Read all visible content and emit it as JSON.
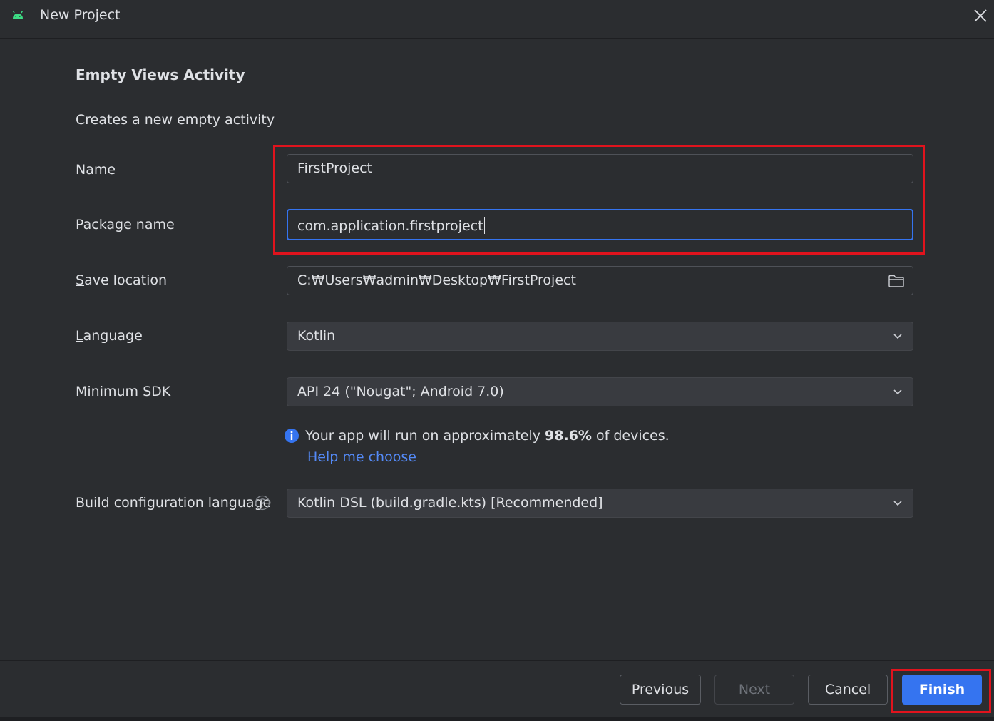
{
  "window": {
    "title": "New Project"
  },
  "template": {
    "heading": "Empty Views Activity",
    "description": "Creates a new empty activity"
  },
  "form": {
    "name": {
      "label_mnemonic": "N",
      "label_rest": "ame",
      "value": "FirstProject"
    },
    "package_name": {
      "label_mnemonic": "P",
      "label_rest": "ackage name",
      "value": "com.application.firstproject"
    },
    "save_location": {
      "label_mnemonic": "S",
      "label_rest": "ave location",
      "value": "C:₩Users₩admin₩Desktop₩FirstProject"
    },
    "language": {
      "label_mnemonic": "L",
      "label_rest": "anguage",
      "value": "Kotlin"
    },
    "minimum_sdk": {
      "label": "Minimum SDK",
      "value": "API 24 (\"Nougat\"; Android 7.0)"
    },
    "sdk_info": {
      "prefix": "Your app will run on approximately ",
      "percent": "98.6%",
      "suffix": " of devices.",
      "help_link": "Help me choose"
    },
    "build_config_language": {
      "label": "Build configuration language",
      "value": "Kotlin DSL (build.gradle.kts) [Recommended]"
    }
  },
  "buttons": {
    "previous": "Previous",
    "next": "Next",
    "cancel": "Cancel",
    "finish": "Finish"
  },
  "colors": {
    "background": "#2b2d30",
    "accent": "#3574f0",
    "link": "#548af7",
    "highlight": "#e0131d",
    "android_green": "#3ddc84"
  }
}
